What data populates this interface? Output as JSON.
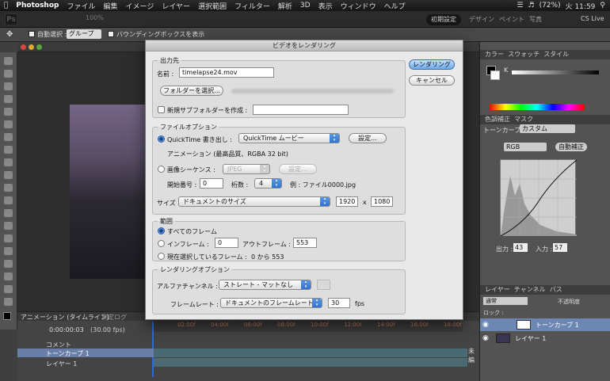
{
  "menubar": {
    "app": "Photoshop",
    "items": [
      "ファイル",
      "編集",
      "イメージ",
      "レイヤー",
      "選択範囲",
      "フィルター",
      "解析",
      "3D",
      "表示",
      "ウィンドウ",
      "ヘルプ"
    ],
    "battery": "(72%)",
    "clock": "火 11:59"
  },
  "appbar": {
    "logo": "Ps",
    "zoom": "100%",
    "workspaces": [
      "初期設定",
      "デザイン",
      "ペイント",
      "写真"
    ],
    "cs_live": "CS Live"
  },
  "optionsbar": {
    "auto_select": "自動選択 :",
    "group": "グループ",
    "bounding_box": "バウンディングボックスを表示"
  },
  "dialog": {
    "title": "ビデオをレンダリング",
    "render_button": "レンダリング",
    "cancel_button": "キャンセル",
    "output": {
      "legend": "出力先",
      "name_label": "名前 :",
      "name_value": "timelapse24.mov",
      "select_folder": "フォルダーを選択...",
      "new_subfolder": "新規サブフォルダーを作成 :"
    },
    "file_options": {
      "legend": "ファイルオプション",
      "quicktime_label": "QuickTime 書き出し :",
      "quicktime_value": "QuickTime ムービー",
      "settings": "設定...",
      "animation_info": "アニメーション (最高品質、RGBA 32 bit)",
      "sequence_label": "画像シーケンス :",
      "sequence_format": "JPEG",
      "sequence_settings": "設定...",
      "start_number_label": "開始番号 :",
      "start_number": "0",
      "digits_label": "桁数 :",
      "digits": "4",
      "example": "例 : ファイル0000.jpg",
      "size_label": "サイズ :",
      "size_value": "ドキュメントのサイズ",
      "width": "1920",
      "times": "x",
      "height": "1080"
    },
    "range": {
      "legend": "範囲",
      "all_frames": "すべてのフレーム",
      "in_frame_label": "インフレーム :",
      "in_frame": "0",
      "out_frame_label": "アウトフレーム :",
      "out_frame": "553",
      "current_selection": "現在選択しているフレーム :",
      "current_range": "0 から 553"
    },
    "render_options": {
      "legend": "レンダリングオプション",
      "alpha_label": "アルファチャンネル :",
      "alpha_value": "ストレート - マットなし",
      "frame_rate_label": "フレームレート :",
      "frame_rate_value": "ドキュメントのフレームレート",
      "fps": "30",
      "fps_unit": "fps"
    }
  },
  "right_panels": {
    "top_tabs": [
      "カラー",
      "スウォッチ",
      "スタイル"
    ],
    "color_k": "K",
    "adjust_tabs": [
      "色調補正",
      "マスク"
    ],
    "curves_label": "トーンカーブ",
    "preset": "カスタム",
    "channel": "RGB",
    "auto": "自動補正",
    "output_label": "出力 :",
    "output_value": "43",
    "input_label": "入力 :",
    "input_value": "57",
    "layer_tabs": [
      "レイヤー",
      "チャンネル",
      "パス"
    ],
    "blend_mode": "通常",
    "opacity_label": "不透明度",
    "lock_label": "ロック :",
    "layers": [
      "トーンカーブ 1",
      "レイヤー 1"
    ]
  },
  "timeline": {
    "tabs": [
      "アニメーション (タイムライン)",
      "測定ログ"
    ],
    "timecode": "0:00:00:03",
    "fps": "(30.00 fps)",
    "ticks": [
      "02:00f",
      "04:00f",
      "06:00f",
      "08:00f",
      "10:00f",
      "12:00f",
      "14:00f",
      "16:00f",
      "18:00f"
    ],
    "tracks": [
      "コメント",
      "トーンカーブ 1",
      "レイヤー 1"
    ],
    "side_label": "未編"
  }
}
